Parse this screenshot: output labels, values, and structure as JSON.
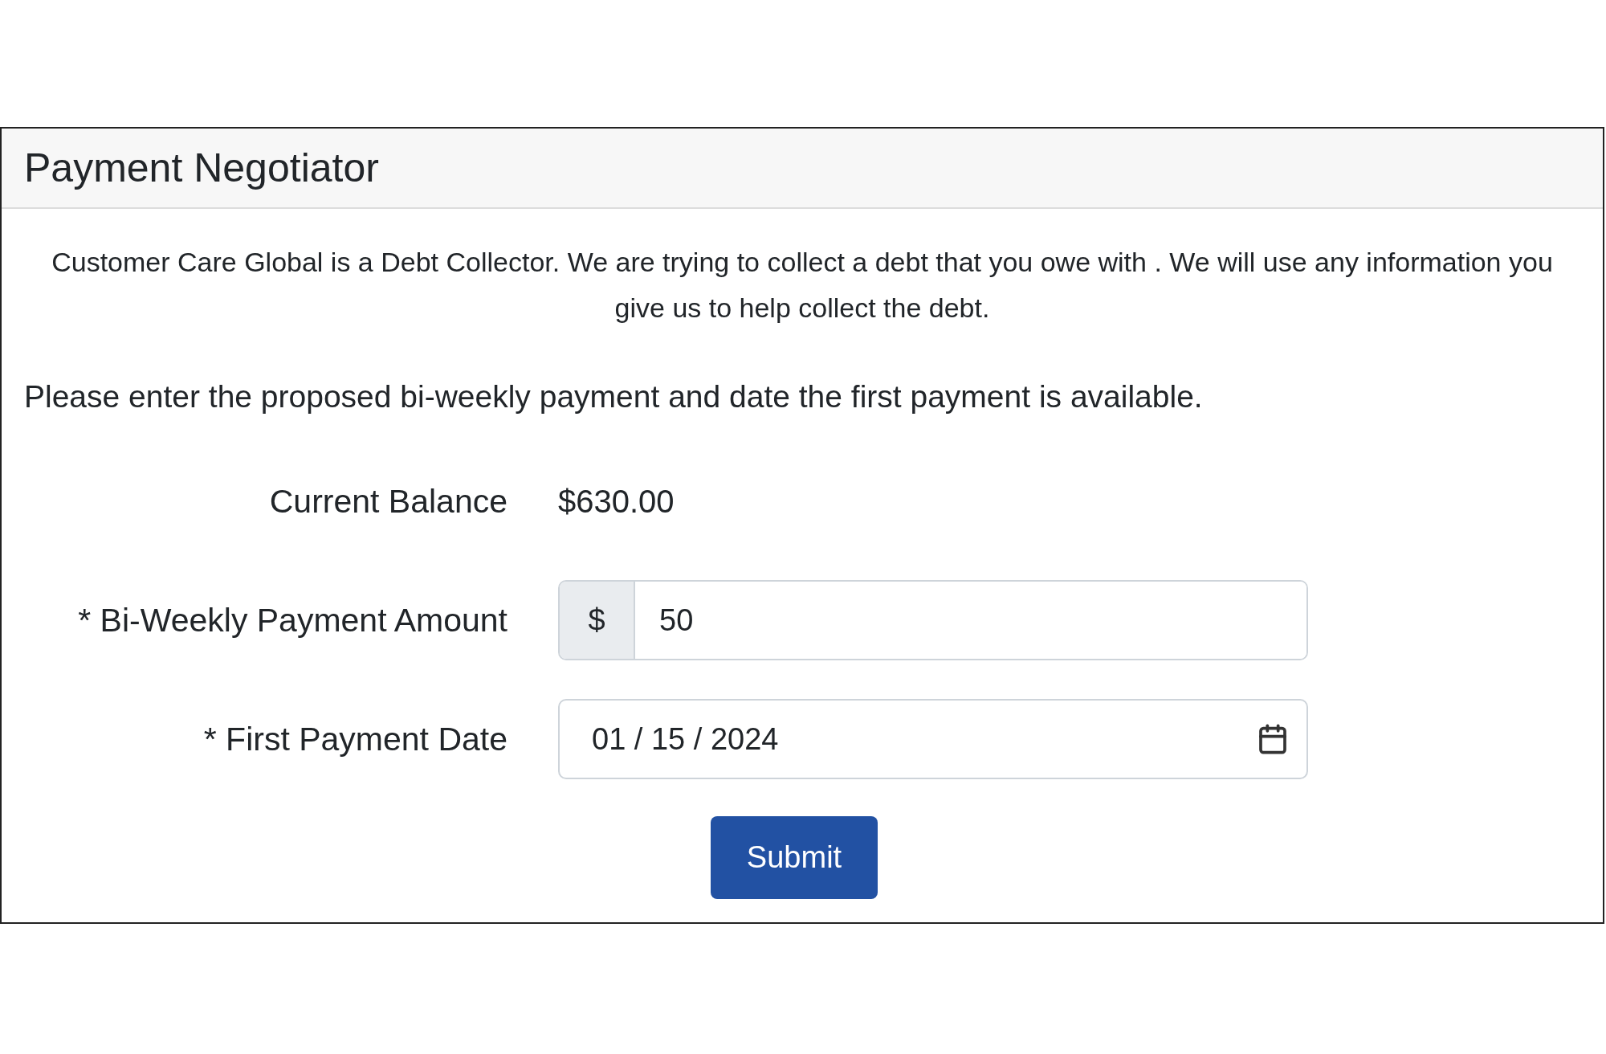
{
  "card": {
    "title": "Payment Negotiator",
    "disclaimer": "Customer Care Global is a Debt Collector. We are trying to collect a debt that you owe with . We will use any information you give us to help collect the debt.",
    "instructions": "Please enter the proposed bi-weekly payment and date the first payment is available.",
    "fields": [
      {
        "kind": "static",
        "label": "Current Balance",
        "value": "$630.00"
      },
      {
        "kind": "amount",
        "label": "* Bi-Weekly Payment Amount",
        "prefix": "$",
        "value": "50"
      },
      {
        "kind": "date",
        "label": "* First Payment Date",
        "value": "01 / 15 / 2024"
      }
    ],
    "submit": "Submit"
  }
}
